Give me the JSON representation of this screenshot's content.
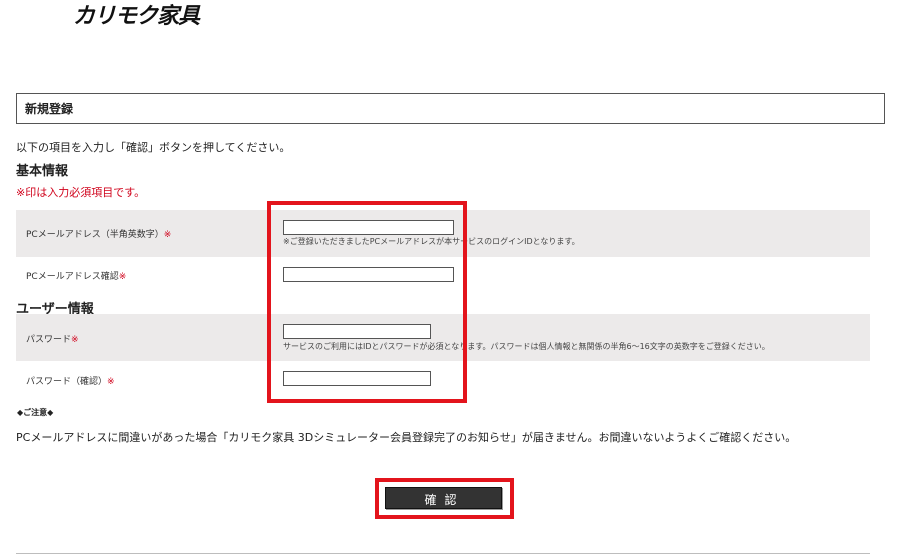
{
  "brand": {
    "logo_text": "カリモク家具"
  },
  "page": {
    "title": "新規登録",
    "intro": "以下の項目を入力し「確認」ボタンを押してください。"
  },
  "basic": {
    "heading": "基本情報",
    "required_note": "※印は入力必須項目です。",
    "email_label": "PCメールアドレス（半角英数字）",
    "email_value": "",
    "email_hint": "※ご登録いただきましたPCメールアドレスが本サービスのログインIDとなります。",
    "email_confirm_label": "PCメールアドレス確認",
    "email_confirm_value": ""
  },
  "user": {
    "heading": "ユーザー情報",
    "password_label": "パスワード",
    "password_value": "",
    "password_hint": "サービスのご利用にはIDとパスワードが必須となります。パスワードは個人情報と無関係の半角6～16文字の英数字をご登録ください。",
    "password_confirm_label": "パスワード（確認）",
    "password_confirm_value": ""
  },
  "required_mark": "※",
  "caution": {
    "title": "◆ご注意◆",
    "text": "PCメールアドレスに間違いがあった場合「カリモク家具 3Dシミュレーター会員登録完了のお知らせ」が届きません。お間違いないようよくご確認ください。"
  },
  "confirm_label": "確認",
  "colors": {
    "required": "#d0021b",
    "highlight": "#e3141c",
    "row_bg": "#eceaea",
    "button": "#333333"
  }
}
